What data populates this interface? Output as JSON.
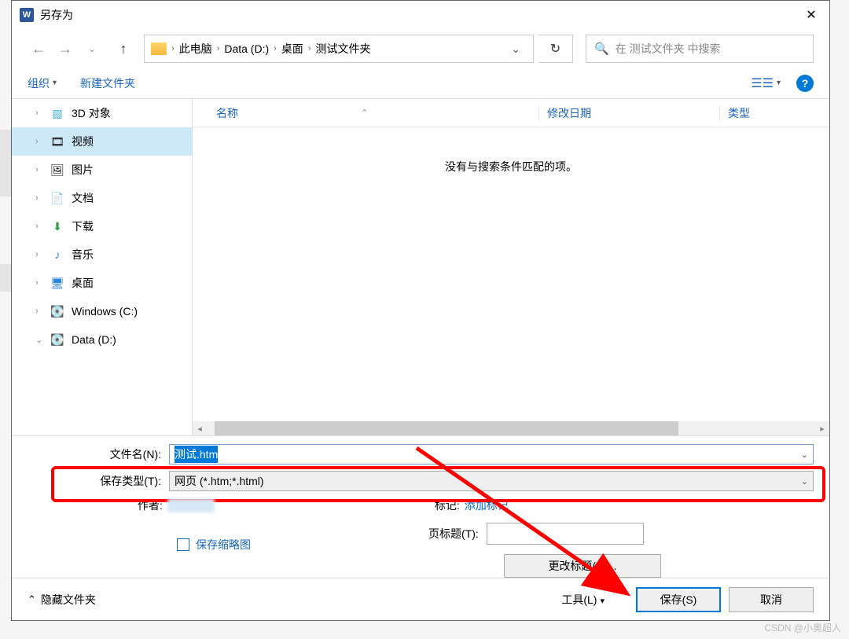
{
  "window": {
    "title": "另存为"
  },
  "breadcrumbs": {
    "items": [
      "此电脑",
      "Data (D:)",
      "桌面",
      "测试文件夹"
    ]
  },
  "search": {
    "placeholder": "在 测试文件夹 中搜索"
  },
  "toolbar": {
    "organize": "组织",
    "new_folder": "新建文件夹"
  },
  "sidebar": {
    "items": [
      {
        "label": "3D 对象",
        "icon": "cube"
      },
      {
        "label": "视频",
        "icon": "film",
        "selected": true
      },
      {
        "label": "图片",
        "icon": "image"
      },
      {
        "label": "文档",
        "icon": "doc"
      },
      {
        "label": "下载",
        "icon": "download"
      },
      {
        "label": "音乐",
        "icon": "music"
      },
      {
        "label": "桌面",
        "icon": "desktop"
      },
      {
        "label": "Windows (C:)",
        "icon": "drive"
      },
      {
        "label": "Data (D:)",
        "icon": "drive",
        "expanded": true
      }
    ]
  },
  "filelist": {
    "col_name": "名称",
    "col_date": "修改日期",
    "col_type": "类型",
    "empty_msg": "没有与搜索条件匹配的项。"
  },
  "form": {
    "filename_label": "文件名(N):",
    "filename_value": "测试.htm",
    "filetype_label": "保存类型(T):",
    "filetype_value": "网页 (*.htm;*.html)",
    "author_label": "作者:",
    "tag_label": "标记:",
    "tag_link": "添加标记",
    "thumbnail_checkbox": "保存缩略图",
    "pagetitle_label": "页标题(T):",
    "changetitle_btn": "更改标题(C)..."
  },
  "footer": {
    "hide_folders": "隐藏文件夹",
    "tools": "工具(L)",
    "save": "保存(S)",
    "cancel": "取消"
  },
  "watermark": "CSDN @小奥超人"
}
